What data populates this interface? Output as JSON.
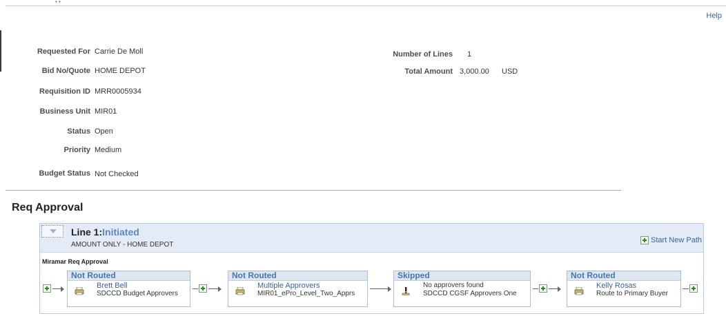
{
  "header": {
    "help_link": "Help"
  },
  "requisition": {
    "fields_left": [
      {
        "label": "Requested For",
        "value": "Carrie De Moll"
      },
      {
        "label": "Bid No/Quote",
        "value": "HOME DEPOT"
      },
      {
        "label": "Requisition ID",
        "value": "MRR0005934"
      },
      {
        "label": "Business Unit",
        "value": "MIR01"
      },
      {
        "label": "Status",
        "value": "Open"
      },
      {
        "label": "Priority",
        "value": "Medium"
      },
      {
        "label": "Budget Status",
        "value": "Not Checked"
      }
    ],
    "fields_right": [
      {
        "label": "Number of Lines",
        "value": "1"
      },
      {
        "label": "Total Amount",
        "value": "3,000.00",
        "currency": "USD"
      }
    ]
  },
  "approval": {
    "section_title": "Req Approval",
    "line": {
      "title": "Line 1:",
      "status": "Initiated",
      "description": "AMOUNT ONLY - HOME DEPOT",
      "start_new_path": "Start New Path",
      "path_name": "Miramar Req Approval",
      "steps": [
        {
          "status": "Not Routed",
          "name": "Brett Bell",
          "role": "SDCCD Budget Approvers",
          "icon": "printer-icon"
        },
        {
          "status": "Not Routed",
          "name": "Multiple Approvers",
          "role": "MIR01_ePro_Level_Two_Apprs",
          "icon": "printer-icon"
        },
        {
          "status": "Skipped",
          "name": "No approvers found",
          "role": "SDCCD CGSF Approvers One",
          "icon": "warning-icon"
        },
        {
          "status": "Not Routed",
          "name": "Kelly Rosas",
          "role": "Route to Primary Buyer",
          "icon": "printer-icon"
        }
      ]
    }
  },
  "colors": {
    "link": "#3b5fa3",
    "status_header": "#4a73b1",
    "panel_header_bg": "#e3ecf6",
    "plus_green": "#2a8a22"
  }
}
